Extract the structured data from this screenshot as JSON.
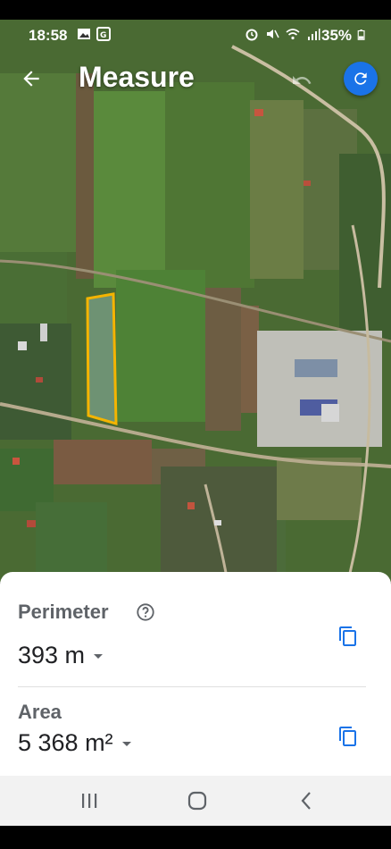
{
  "status_bar": {
    "time": "18:58",
    "battery": "35%"
  },
  "app_bar": {
    "title": "Measure",
    "back_icon": "arrow-back-icon",
    "undo_icon": "undo-icon",
    "refresh_icon": "refresh-icon",
    "accent": "#1a73e8"
  },
  "map": {
    "polygon_color": "#f4b400"
  },
  "sheet": {
    "perimeter_label": "Perimeter",
    "perimeter_value": "393 m",
    "area_label": "Area",
    "area_value": "5 368 m²",
    "help_icon": "help-circle-icon",
    "copy_icon": "copy-icon"
  },
  "navbar": {
    "icons": [
      "recent-apps-icon",
      "home-icon",
      "back-icon"
    ]
  }
}
